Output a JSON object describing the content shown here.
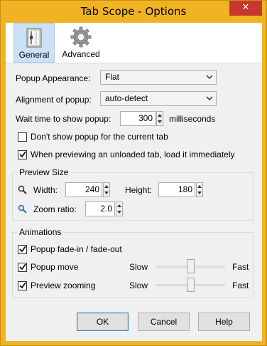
{
  "window": {
    "title": "Tab Scope - Options",
    "close_glyph": "✕"
  },
  "toolbar": {
    "tabs": [
      {
        "label": "General",
        "icon": "settings-sliders-icon",
        "active": true
      },
      {
        "label": "Advanced",
        "icon": "gear-icon",
        "active": false
      }
    ]
  },
  "general": {
    "popup_appearance": {
      "label": "Popup Appearance:",
      "value": "Flat"
    },
    "alignment": {
      "label": "Alignment of popup:",
      "value": "auto-detect"
    },
    "wait_time": {
      "label": "Wait time to show popup:",
      "value": "300",
      "unit": "milliseconds"
    },
    "dont_show_current": {
      "label": "Don't show popup for the current tab",
      "checked": false
    },
    "load_unloaded": {
      "label": "When previewing an unloaded tab, load it immediately",
      "checked": true
    }
  },
  "preview_size": {
    "title": "Preview Size",
    "width": {
      "label": "Width:",
      "value": "240"
    },
    "height": {
      "label": "Height:",
      "value": "180"
    },
    "zoom": {
      "label": "Zoom ratio:",
      "value": "2.0"
    }
  },
  "animations": {
    "title": "Animations",
    "fade": {
      "label": "Popup fade-in / fade-out",
      "checked": true
    },
    "move": {
      "label": "Popup move",
      "checked": true,
      "slow": "Slow",
      "fast": "Fast",
      "level": 0.5
    },
    "zoom": {
      "label": "Preview zooming",
      "checked": true,
      "slow": "Slow",
      "fast": "Fast",
      "level": 0.5
    }
  },
  "buttons": {
    "ok": "OK",
    "cancel": "Cancel",
    "help": "Help"
  },
  "colors": {
    "title_bar": "#f0b323",
    "close": "#c7372f",
    "active_tab": "#cce0f6"
  }
}
